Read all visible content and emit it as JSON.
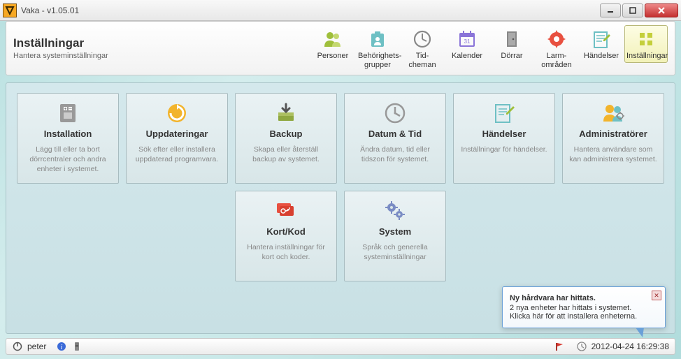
{
  "window": {
    "title": "Vaka - v1.05.01"
  },
  "header": {
    "title": "Inställningar",
    "subtitle": "Hantera systeminställningar"
  },
  "nav": [
    {
      "label": "Personer",
      "icon": "persons"
    },
    {
      "label": "Behörighets-\ngrupper",
      "icon": "badge"
    },
    {
      "label": "Tid-\ncheman",
      "icon": "clock"
    },
    {
      "label": "Kalender",
      "icon": "calendar"
    },
    {
      "label": "Dörrar",
      "icon": "door"
    },
    {
      "label": "Larm-\nområden",
      "icon": "alarm"
    },
    {
      "label": "Händelser",
      "icon": "events"
    },
    {
      "label": "Inställningar",
      "icon": "settings",
      "active": true
    }
  ],
  "tiles": [
    {
      "id": "installation",
      "title": "Installation",
      "desc": "Lägg till eller ta bort dörrcentraler och andra enheter i systemet.",
      "icon": "install"
    },
    {
      "id": "updates",
      "title": "Uppdateringar",
      "desc": "Sök efter eller installera uppdaterad programvara.",
      "icon": "updates"
    },
    {
      "id": "backup",
      "title": "Backup",
      "desc": "Skapa eller återställ backup av systemet.",
      "icon": "backup"
    },
    {
      "id": "datetime",
      "title": "Datum & Tid",
      "desc": "Ändra datum, tid eller tidszon för systemet.",
      "icon": "datetime"
    },
    {
      "id": "events",
      "title": "Händelser",
      "desc": "Inställningar för händelser.",
      "icon": "events2"
    },
    {
      "id": "admins",
      "title": "Administratörer",
      "desc": "Hantera användare som kan administrera systemet.",
      "icon": "admins"
    },
    {
      "id": "cardcode",
      "title": "Kort/Kod",
      "desc": "Hantera inställningar för kort och koder.",
      "icon": "cardcode"
    },
    {
      "id": "system",
      "title": "System",
      "desc": "Språk och generella systeminställningar",
      "icon": "system"
    }
  ],
  "notification": {
    "title": "Ny hårdvara har hittats.",
    "line1": "2 nya enheter har hittats i systemet.",
    "line2": "Klicka här för att installera enheterna."
  },
  "statusbar": {
    "user": "peter",
    "datetime": "2012-04-24 16:29:38"
  }
}
